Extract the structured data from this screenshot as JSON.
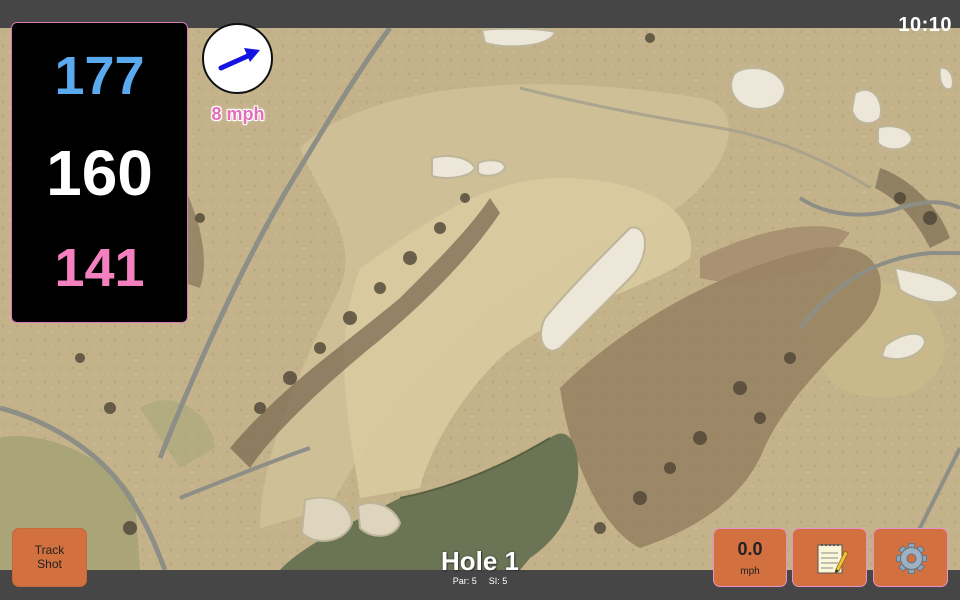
{
  "status_bar": {
    "time": "10:10"
  },
  "distances": {
    "back": "177",
    "middle": "160",
    "front": "141",
    "colors": {
      "back": "#5aaaf0",
      "middle": "#ffffff",
      "front": "#f480c0"
    }
  },
  "wind": {
    "speed_label": "8 mph",
    "arrow_color": "#1414e0",
    "direction_icon": "wind-arrow-icon"
  },
  "hole": {
    "title": "Hole 1",
    "par": "Par: 5",
    "si": "SI: 5"
  },
  "buttons": {
    "track_shot": "Track\nShot",
    "speed_value": "0.0",
    "speed_unit": "mph",
    "notes_icon": "notepad-icon",
    "settings_icon": "gear-icon",
    "accent": "#d2703f"
  },
  "map": {
    "type": "aerial golf course view"
  }
}
